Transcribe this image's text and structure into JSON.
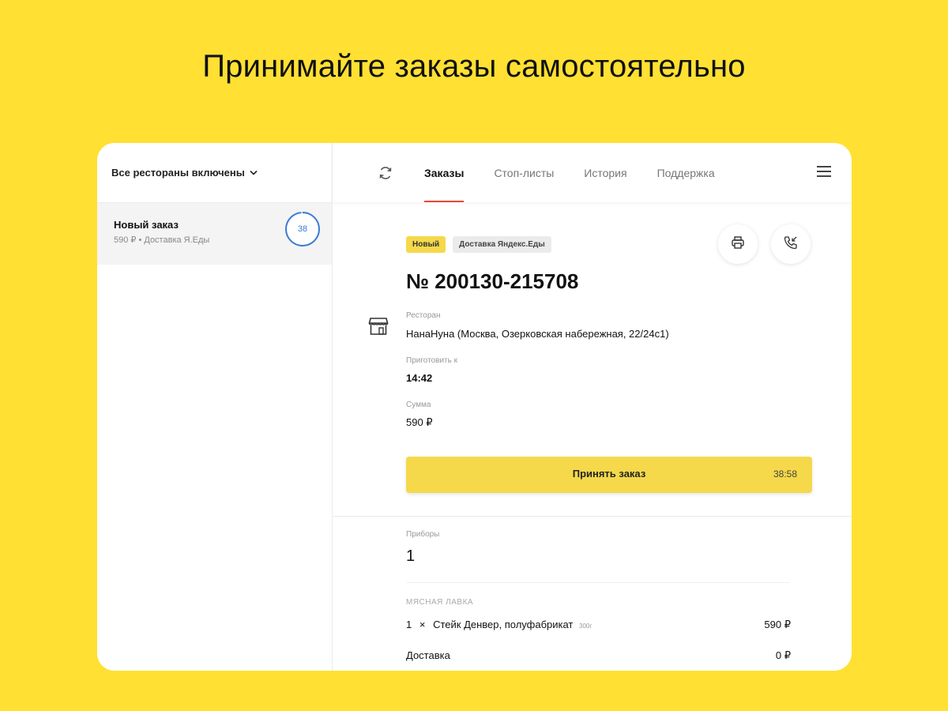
{
  "headline": "Принимайте заказы самостоятельно",
  "sidebar": {
    "restaurant_filter": "Все рестораны включены",
    "orders": [
      {
        "title": "Новый заказ",
        "subtitle": "590 ₽ • Доставка Я.Еды",
        "timer": "38"
      }
    ]
  },
  "topbar": {
    "tabs": [
      {
        "label": "Заказы",
        "active": true
      },
      {
        "label": "Стоп-листы",
        "active": false
      },
      {
        "label": "История",
        "active": false
      },
      {
        "label": "Поддержка",
        "active": false
      }
    ]
  },
  "order": {
    "badges": {
      "status": "Новый",
      "delivery": "Доставка Яндекс.Еды"
    },
    "number": "№ 200130-215708",
    "restaurant_label": "Ресторан",
    "restaurant_value": "НанаНуна (Москва, Озерковская набережная, 22/24с1)",
    "prepare_label": "Приготовить к",
    "prepare_value": "14:42",
    "sum_label": "Сумма",
    "sum_value": "590 ₽",
    "accept_label": "Принять заказ",
    "accept_timer": "38:58",
    "cutlery_label": "Приборы",
    "cutlery_value": "1",
    "section_title": "МЯСНАЯ ЛАВКА",
    "item": {
      "qty": "1",
      "times": "×",
      "name": "Стейк Денвер, полуфабрикат",
      "weight": "300г",
      "price": "590 ₽"
    },
    "delivery_label": "Доставка",
    "delivery_price": "0 ₽"
  },
  "colors": {
    "background": "#FFE033",
    "accent_yellow": "#F5D94A",
    "active_tab_underline": "#E8473A",
    "timer_blue": "#3A7BD5"
  },
  "icons": {
    "refresh": "refresh-icon",
    "menu": "menu-icon",
    "print": "printer-icon",
    "call": "phone-callback-icon",
    "store": "store-icon",
    "chevron": "chevron-down-icon"
  }
}
